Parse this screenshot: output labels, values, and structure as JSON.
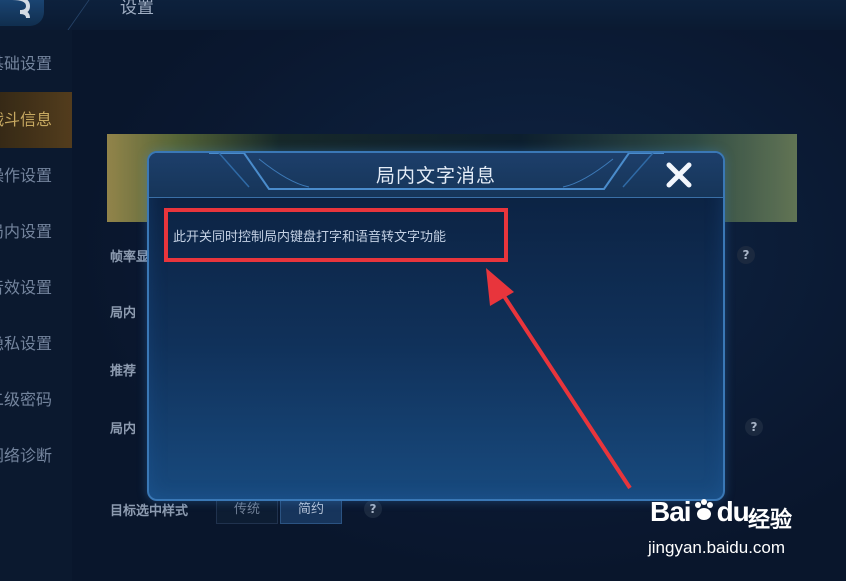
{
  "header": {
    "title": "设置"
  },
  "sidebar": {
    "items": [
      {
        "label": "基础设置"
      },
      {
        "label": "战斗信息"
      },
      {
        "label": "操作设置"
      },
      {
        "label": "局内设置"
      },
      {
        "label": "音效设置"
      },
      {
        "label": "隐私设置"
      },
      {
        "label": "二级密码"
      },
      {
        "label": "网络诊断"
      }
    ]
  },
  "settings": {
    "rows": [
      {
        "label": "帧率显"
      },
      {
        "label": "局内"
      },
      {
        "label": "推荐"
      },
      {
        "label": "局内"
      }
    ],
    "target_style": {
      "label": "目标选中样式",
      "options": [
        "传统",
        "简约"
      ],
      "selected": "简约"
    },
    "help_glyph": "?"
  },
  "dialog": {
    "title": "局内文字消息",
    "body": "此开关同时控制局内键盘打字和语音转文字功能",
    "close_icon": "close-x-icon"
  },
  "annotation": {
    "color": "#e8353c"
  },
  "watermark": {
    "brand": "Bai",
    "brand_suffix": "du",
    "sub": "经验",
    "url": "jingyan.baidu.com"
  }
}
